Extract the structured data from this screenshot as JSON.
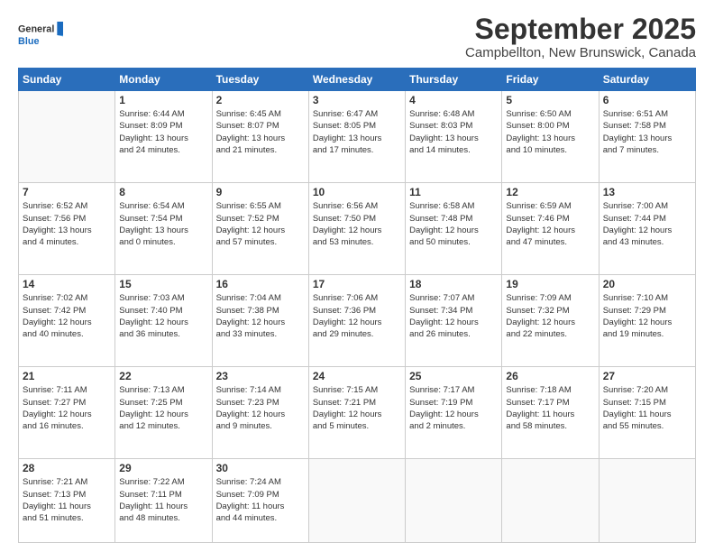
{
  "header": {
    "logo_general": "General",
    "logo_blue": "Blue",
    "month_title": "September 2025",
    "location": "Campbellton, New Brunswick, Canada"
  },
  "days_of_week": [
    "Sunday",
    "Monday",
    "Tuesday",
    "Wednesday",
    "Thursday",
    "Friday",
    "Saturday"
  ],
  "weeks": [
    [
      {
        "day": "",
        "text": ""
      },
      {
        "day": "1",
        "text": "Sunrise: 6:44 AM\nSunset: 8:09 PM\nDaylight: 13 hours\nand 24 minutes."
      },
      {
        "day": "2",
        "text": "Sunrise: 6:45 AM\nSunset: 8:07 PM\nDaylight: 13 hours\nand 21 minutes."
      },
      {
        "day": "3",
        "text": "Sunrise: 6:47 AM\nSunset: 8:05 PM\nDaylight: 13 hours\nand 17 minutes."
      },
      {
        "day": "4",
        "text": "Sunrise: 6:48 AM\nSunset: 8:03 PM\nDaylight: 13 hours\nand 14 minutes."
      },
      {
        "day": "5",
        "text": "Sunrise: 6:50 AM\nSunset: 8:00 PM\nDaylight: 13 hours\nand 10 minutes."
      },
      {
        "day": "6",
        "text": "Sunrise: 6:51 AM\nSunset: 7:58 PM\nDaylight: 13 hours\nand 7 minutes."
      }
    ],
    [
      {
        "day": "7",
        "text": "Sunrise: 6:52 AM\nSunset: 7:56 PM\nDaylight: 13 hours\nand 4 minutes."
      },
      {
        "day": "8",
        "text": "Sunrise: 6:54 AM\nSunset: 7:54 PM\nDaylight: 13 hours\nand 0 minutes."
      },
      {
        "day": "9",
        "text": "Sunrise: 6:55 AM\nSunset: 7:52 PM\nDaylight: 12 hours\nand 57 minutes."
      },
      {
        "day": "10",
        "text": "Sunrise: 6:56 AM\nSunset: 7:50 PM\nDaylight: 12 hours\nand 53 minutes."
      },
      {
        "day": "11",
        "text": "Sunrise: 6:58 AM\nSunset: 7:48 PM\nDaylight: 12 hours\nand 50 minutes."
      },
      {
        "day": "12",
        "text": "Sunrise: 6:59 AM\nSunset: 7:46 PM\nDaylight: 12 hours\nand 47 minutes."
      },
      {
        "day": "13",
        "text": "Sunrise: 7:00 AM\nSunset: 7:44 PM\nDaylight: 12 hours\nand 43 minutes."
      }
    ],
    [
      {
        "day": "14",
        "text": "Sunrise: 7:02 AM\nSunset: 7:42 PM\nDaylight: 12 hours\nand 40 minutes."
      },
      {
        "day": "15",
        "text": "Sunrise: 7:03 AM\nSunset: 7:40 PM\nDaylight: 12 hours\nand 36 minutes."
      },
      {
        "day": "16",
        "text": "Sunrise: 7:04 AM\nSunset: 7:38 PM\nDaylight: 12 hours\nand 33 minutes."
      },
      {
        "day": "17",
        "text": "Sunrise: 7:06 AM\nSunset: 7:36 PM\nDaylight: 12 hours\nand 29 minutes."
      },
      {
        "day": "18",
        "text": "Sunrise: 7:07 AM\nSunset: 7:34 PM\nDaylight: 12 hours\nand 26 minutes."
      },
      {
        "day": "19",
        "text": "Sunrise: 7:09 AM\nSunset: 7:32 PM\nDaylight: 12 hours\nand 22 minutes."
      },
      {
        "day": "20",
        "text": "Sunrise: 7:10 AM\nSunset: 7:29 PM\nDaylight: 12 hours\nand 19 minutes."
      }
    ],
    [
      {
        "day": "21",
        "text": "Sunrise: 7:11 AM\nSunset: 7:27 PM\nDaylight: 12 hours\nand 16 minutes."
      },
      {
        "day": "22",
        "text": "Sunrise: 7:13 AM\nSunset: 7:25 PM\nDaylight: 12 hours\nand 12 minutes."
      },
      {
        "day": "23",
        "text": "Sunrise: 7:14 AM\nSunset: 7:23 PM\nDaylight: 12 hours\nand 9 minutes."
      },
      {
        "day": "24",
        "text": "Sunrise: 7:15 AM\nSunset: 7:21 PM\nDaylight: 12 hours\nand 5 minutes."
      },
      {
        "day": "25",
        "text": "Sunrise: 7:17 AM\nSunset: 7:19 PM\nDaylight: 12 hours\nand 2 minutes."
      },
      {
        "day": "26",
        "text": "Sunrise: 7:18 AM\nSunset: 7:17 PM\nDaylight: 11 hours\nand 58 minutes."
      },
      {
        "day": "27",
        "text": "Sunrise: 7:20 AM\nSunset: 7:15 PM\nDaylight: 11 hours\nand 55 minutes."
      }
    ],
    [
      {
        "day": "28",
        "text": "Sunrise: 7:21 AM\nSunset: 7:13 PM\nDaylight: 11 hours\nand 51 minutes."
      },
      {
        "day": "29",
        "text": "Sunrise: 7:22 AM\nSunset: 7:11 PM\nDaylight: 11 hours\nand 48 minutes."
      },
      {
        "day": "30",
        "text": "Sunrise: 7:24 AM\nSunset: 7:09 PM\nDaylight: 11 hours\nand 44 minutes."
      },
      {
        "day": "",
        "text": ""
      },
      {
        "day": "",
        "text": ""
      },
      {
        "day": "",
        "text": ""
      },
      {
        "day": "",
        "text": ""
      }
    ]
  ]
}
